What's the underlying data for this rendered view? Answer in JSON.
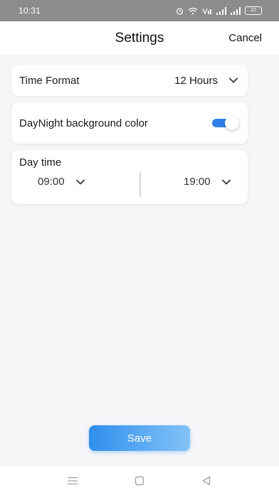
{
  "status_bar": {
    "time": "10:31",
    "battery": "22"
  },
  "header": {
    "title": "Settings",
    "cancel_label": "Cancel"
  },
  "time_format": {
    "label": "Time Format",
    "value": "12 Hours"
  },
  "daynight": {
    "label": "DayNight background color",
    "enabled": true
  },
  "daytime": {
    "label": "Day time",
    "start": "09:00",
    "end": "19:00"
  },
  "save_label": "Save",
  "colors": {
    "accent": "#2f7fe6",
    "save_gradient_start": "#2f8fee",
    "save_gradient_end": "#83c2f7",
    "status_bar": "#8c8c8c",
    "background": "#f6f6f8"
  },
  "icons": {
    "status": [
      "alarm-icon",
      "wifi-icon",
      "volte-icon",
      "signal-icon",
      "signal-icon",
      "battery-icon"
    ],
    "nav": [
      "menu-icon",
      "home-icon",
      "back-icon"
    ]
  }
}
